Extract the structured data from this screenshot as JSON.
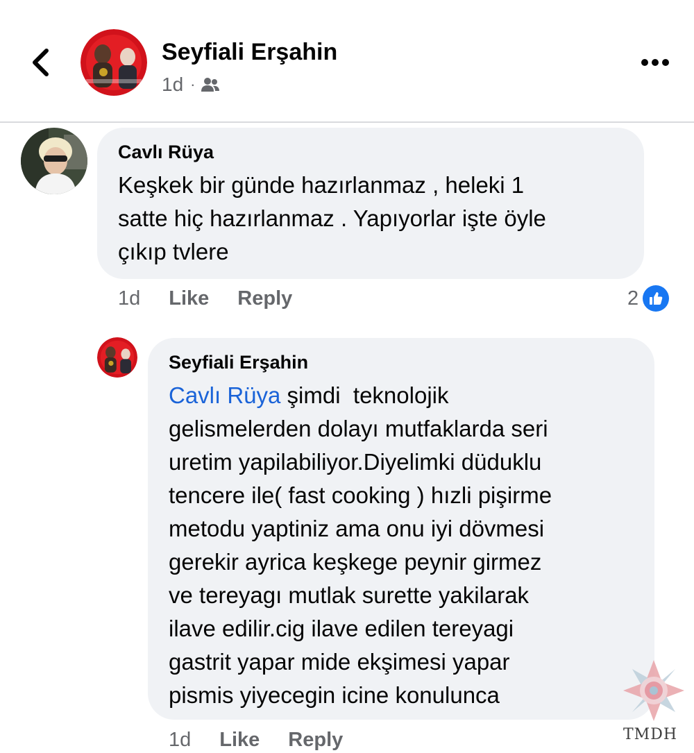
{
  "post_header": {
    "back_icon": "chevron-left-icon",
    "author_name": "Seyfiali Erşahin",
    "time": "1d",
    "separator": "·",
    "audience_icon": "friends-icon",
    "more_icon": "more-horizontal-icon"
  },
  "comments": [
    {
      "author": "Cavlı Rüya",
      "lines": [
        "Keşkek bir günde hazırlanmaz , heleki 1",
        "satte hiç hazırlanmaz . Yapıyorlar işte öyle",
        "çıkıp tvlere"
      ],
      "time": "1d",
      "like_label": "Like",
      "reply_label": "Reply",
      "reaction_count": "2",
      "reaction_icon": "like-thumb-icon",
      "reaction_color": "#1877f2"
    }
  ],
  "reply": {
    "author": "Seyfiali Erşahin",
    "mention": "Cavlı Rüya",
    "first_line_rest": " şimdi  teknolojik",
    "lines": [
      "gelismelerden dolayı mutfaklarda  seri",
      "uretim  yapilabiliyor.Diyelimki düduklu",
      "tencere ile( fast cooking ) hızli pişirme",
      "metodu yaptiniz ama onu iyi dövmesi",
      "gerekir  ayrica keşkege   peynir girmez",
      "ve tereyagı mutlak surette yakilarak",
      "ilave edilir.cig ilave edilen tereyagi",
      "gastrit yapar mide ekşimesi yapar",
      "pismis yiyecegin icine konulunca"
    ],
    "time": "1d",
    "like_label": "Like",
    "reply_label": "Reply",
    "mention_color": "#1a63d8"
  },
  "watermark": {
    "text": "TMDH"
  }
}
